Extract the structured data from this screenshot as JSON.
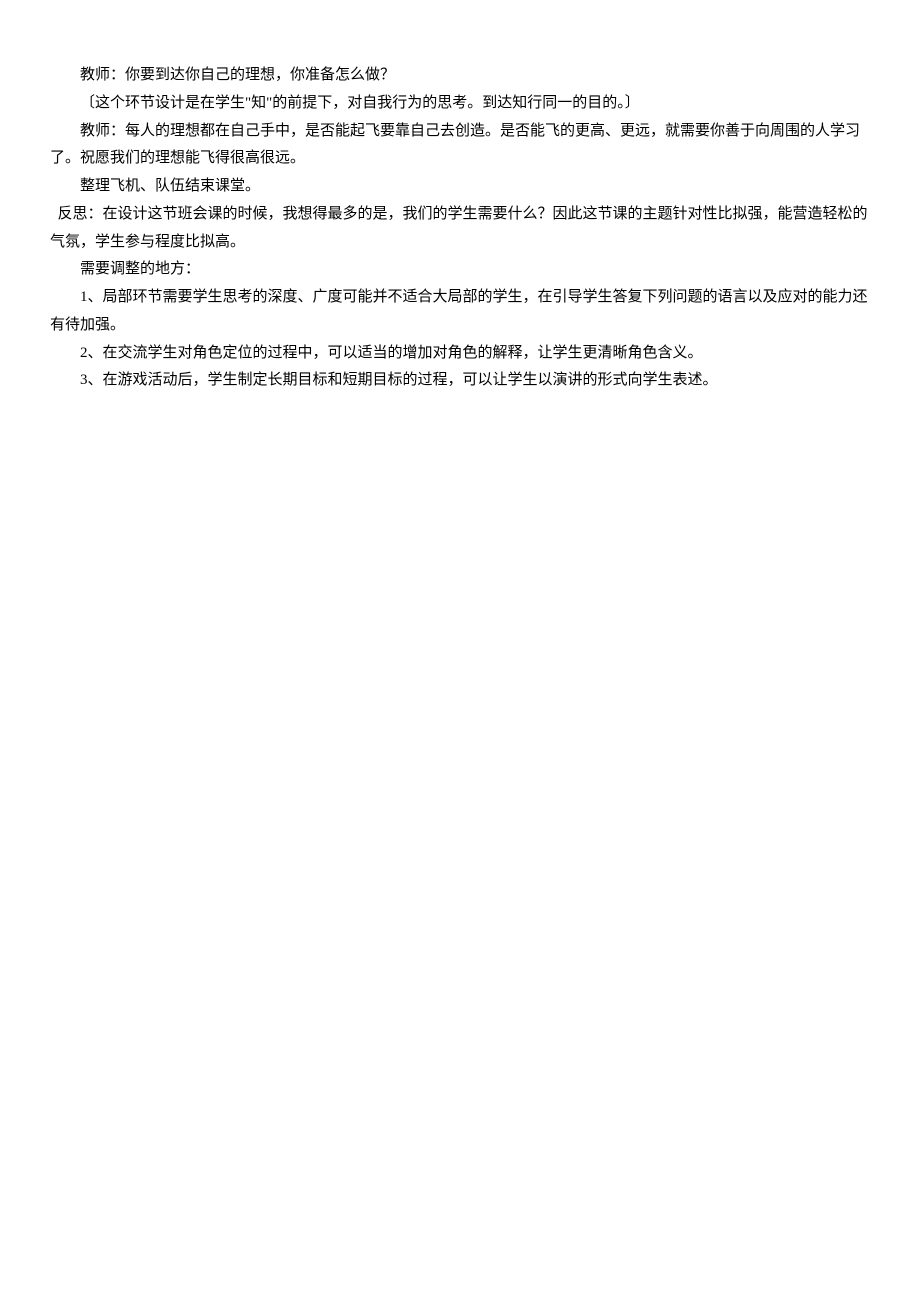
{
  "lines": {
    "l1": "教师：你要到达你自己的理想，你准备怎么做？",
    "l2": "〔这个环节设计是在学生\"知\"的前提下，对自我行为的思考。到达知行同一的目的。〕",
    "l3": "教师：每人的理想都在自己手中，是否能起飞要靠自己去创造。是否能飞的更高、更远，就需要你善于向周围的人学习了。祝愿我们的理想能飞得很高很远。",
    "l4": "整理飞机、队伍结束课堂。",
    "l5": "反思：在设计这节班会课的时候，我想得最多的是，我们的学生需要什么？因此这节课的主题针对性比拟强，能营造轻松的气氛，学生参与程度比拟高。",
    "l6": "需要调整的地方：",
    "l7": "1、局部环节需要学生思考的深度、广度可能并不适合大局部的学生，在引导学生答复下列问题的语言以及应对的能力还有待加强。",
    "l8": "2、在交流学生对角色定位的过程中，可以适当的增加对角色的解释，让学生更清晰角色含义。",
    "l9": "3、在游戏活动后，学生制定长期目标和短期目标的过程，可以让学生以演讲的形式向学生表述。"
  }
}
